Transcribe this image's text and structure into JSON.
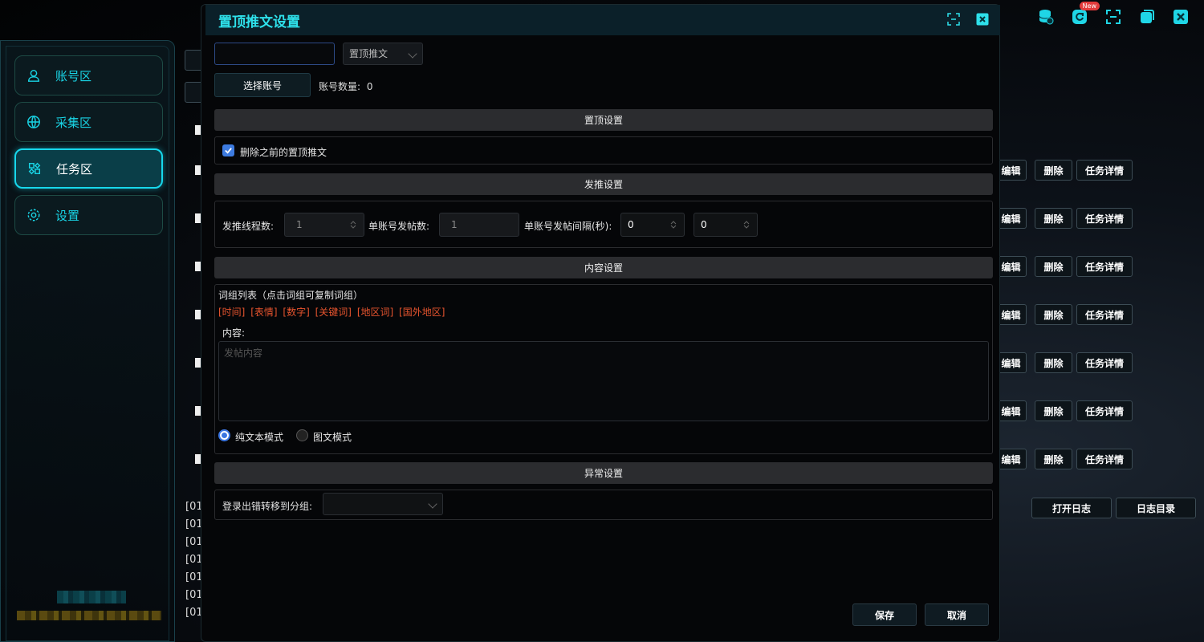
{
  "topbar": {
    "icons": [
      "database-icon",
      "refresh-icon",
      "fullscreen-icon",
      "window-icon",
      "close-icon"
    ],
    "badge": "New"
  },
  "sidebar": {
    "items": [
      {
        "label": "账号区",
        "icon": "user-icon"
      },
      {
        "label": "采集区",
        "icon": "globe-icon"
      },
      {
        "label": "任务区",
        "icon": "tasks-icon"
      },
      {
        "label": "设置",
        "icon": "gear-icon"
      }
    ],
    "active_index": 2
  },
  "background": {
    "row_actions": {
      "edit": "编辑",
      "delete": "删除",
      "detail": "任务详情"
    },
    "open_log": "打开日志",
    "log_dir": "日志目录",
    "log_lines": [
      "[01",
      "[01",
      "[01",
      "[01",
      "[01",
      "[01",
      "[01"
    ]
  },
  "modal": {
    "title": "置顶推文设置",
    "type_select": "置顶推文",
    "select_account": "选择账号",
    "account_count_label": "账号数量:",
    "account_count": "0",
    "sections": {
      "pin": "置顶设置",
      "post": "发推设置",
      "content": "内容设置",
      "error": "异常设置"
    },
    "delete_previous_label": "删除之前的置顶推文",
    "delete_previous_checked": true,
    "threads_label": "发推线程数:",
    "threads_value": "1",
    "per_account_label": "单账号发帖数:",
    "per_account_value": "1",
    "interval_label": "单账号发帖间隔(秒):",
    "interval_min": "0",
    "interval_max": "0",
    "phrase_list_label": "词组列表（点击词组可复制词组）",
    "phrase_tags": [
      "[时间]",
      "[表情]",
      "[数字]",
      "[关键词]",
      "[地区词]",
      "[国外地区]"
    ],
    "content_label": "内容:",
    "content_placeholder": "发帖内容",
    "mode_text": "纯文本模式",
    "mode_image": "图文模式",
    "mode_selected": "纯文本模式",
    "login_error_label": "登录出错转移到分组:",
    "save": "保存",
    "cancel": "取消"
  },
  "colors": {
    "accent": "#17d8ec",
    "title": "#2ee0ea",
    "tag": "#e6542e",
    "checkbox": "#3d7be0"
  }
}
